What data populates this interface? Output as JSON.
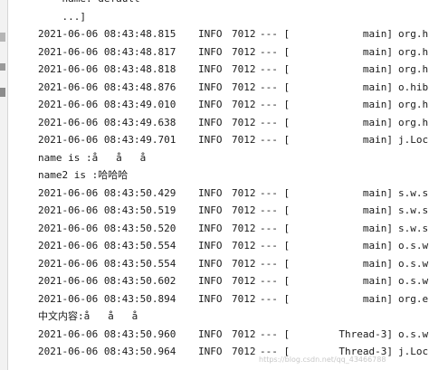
{
  "yaml_tail": {
    "name_line": "    name: default",
    "close_line": "    ...]"
  },
  "log_block_1": [
    {
      "ts": "2021-06-06 08:43:48.815",
      "level": "INFO",
      "pid": "7012",
      "sep": "--- [",
      "thread": "main]",
      "logger": "org.h"
    },
    {
      "ts": "2021-06-06 08:43:48.817",
      "level": "INFO",
      "pid": "7012",
      "sep": "--- [",
      "thread": "main]",
      "logger": "org.h"
    },
    {
      "ts": "2021-06-06 08:43:48.818",
      "level": "INFO",
      "pid": "7012",
      "sep": "--- [",
      "thread": "main]",
      "logger": "org.h"
    },
    {
      "ts": "2021-06-06 08:43:48.876",
      "level": "INFO",
      "pid": "7012",
      "sep": "--- [",
      "thread": "main]",
      "logger": "o.hib"
    },
    {
      "ts": "2021-06-06 08:43:49.010",
      "level": "INFO",
      "pid": "7012",
      "sep": "--- [",
      "thread": "main]",
      "logger": "org.h"
    },
    {
      "ts": "2021-06-06 08:43:49.638",
      "level": "INFO",
      "pid": "7012",
      "sep": "--- [",
      "thread": "main]",
      "logger": "org.h"
    },
    {
      "ts": "2021-06-06 08:43:49.701",
      "level": "INFO",
      "pid": "7012",
      "sep": "--- [",
      "thread": "main]",
      "logger": "j.Loc"
    }
  ],
  "output_lines_1": [
    "name is :å   å   å",
    "name2 is :哈哈哈"
  ],
  "log_block_2": [
    {
      "ts": "2021-06-06 08:43:50.429",
      "level": "INFO",
      "pid": "7012",
      "sep": "--- [",
      "thread": "main]",
      "logger": "s.w.s"
    },
    {
      "ts": "2021-06-06 08:43:50.519",
      "level": "INFO",
      "pid": "7012",
      "sep": "--- [",
      "thread": "main]",
      "logger": "s.w.s"
    },
    {
      "ts": "2021-06-06 08:43:50.520",
      "level": "INFO",
      "pid": "7012",
      "sep": "--- [",
      "thread": "main]",
      "logger": "s.w.s"
    },
    {
      "ts": "2021-06-06 08:43:50.554",
      "level": "INFO",
      "pid": "7012",
      "sep": "--- [",
      "thread": "main]",
      "logger": "o.s.w"
    },
    {
      "ts": "2021-06-06 08:43:50.554",
      "level": "INFO",
      "pid": "7012",
      "sep": "--- [",
      "thread": "main]",
      "logger": "o.s.w"
    },
    {
      "ts": "2021-06-06 08:43:50.602",
      "level": "INFO",
      "pid": "7012",
      "sep": "--- [",
      "thread": "main]",
      "logger": "o.s.w"
    },
    {
      "ts": "2021-06-06 08:43:50.894",
      "level": "INFO",
      "pid": "7012",
      "sep": "--- [",
      "thread": "main]",
      "logger": "org.e"
    }
  ],
  "output_lines_2": [
    "中文内容:å   å   å"
  ],
  "log_block_3": [
    {
      "ts": "2021-06-06 08:43:50.960",
      "level": "INFO",
      "pid": "7012",
      "sep": "--- [",
      "thread": "Thread-3]",
      "logger": "o.s.w"
    },
    {
      "ts": "2021-06-06 08:43:50.964",
      "level": "INFO",
      "pid": "7012",
      "sep": "--- [",
      "thread": "Thread-3]",
      "logger": "j.Loc"
    }
  ],
  "watermark": "https://blog.csdn.net/qq_43466788"
}
